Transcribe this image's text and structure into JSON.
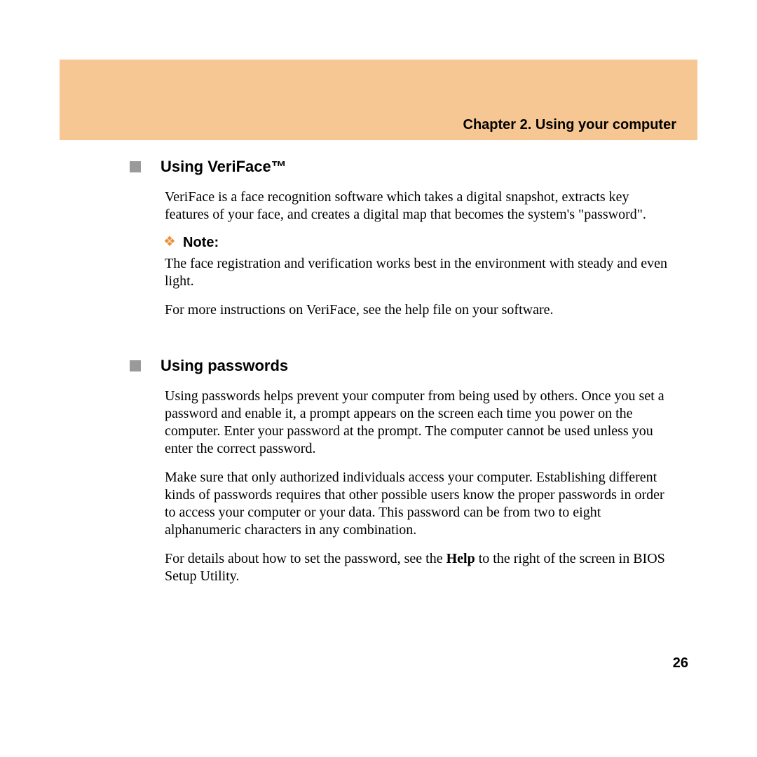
{
  "header": {
    "chapter": "Chapter 2. Using your computer"
  },
  "sections": {
    "veriface": {
      "title": "Using VeriFace™",
      "intro": "VeriFace is a face recognition software which takes a digital snapshot, extracts key features of your face, and creates a digital map that becomes the system's \"password\".",
      "note_label": "Note:",
      "note_body": "The face registration and verification works best in the environment with steady and even light.",
      "more": "For more instructions on VeriFace, see the help file on your software."
    },
    "passwords": {
      "title": "Using passwords",
      "p1": "Using passwords helps prevent your computer from being used by others. Once you set a password and enable it, a prompt appears on the screen each time you power on the computer. Enter your password at the prompt. The computer cannot be used unless you enter the correct password.",
      "p2": "Make sure that only authorized individuals access your computer. Establishing different kinds of passwords requires that other possible users know the proper passwords in order to access your computer or your data. This password can be from two to eight alphanumeric characters in any combination.",
      "p3_pre": "For details about how to set the password, see the ",
      "p3_bold": "Help",
      "p3_post": " to the right of the screen in BIOS Setup Utility."
    }
  },
  "page_number": "26"
}
